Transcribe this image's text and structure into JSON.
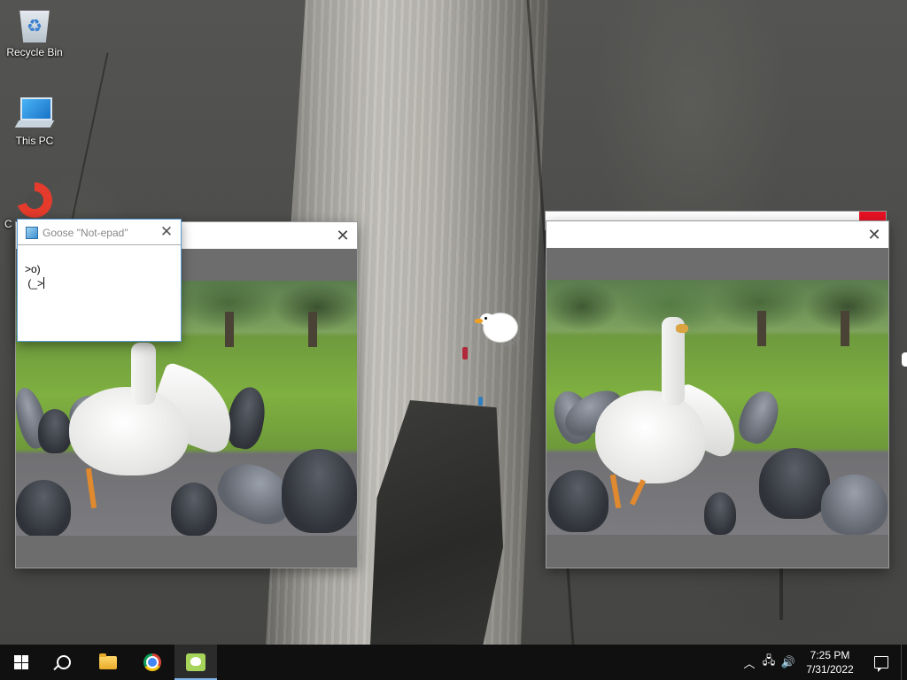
{
  "desktop": {
    "icons": [
      {
        "label": "Recycle Bin",
        "icon": "recycle-bin-icon"
      },
      {
        "label": "This PC",
        "icon": "this-pc-icon"
      },
      {
        "label": "C",
        "icon": "ccleaner-icon"
      }
    ]
  },
  "notepad": {
    "title": "Goose \"Not-epad\"",
    "close_glyph": "✕",
    "content": ">o)\n (_>"
  },
  "video_windows": [
    {
      "close_glyph": "✕"
    },
    {
      "close_glyph": "✕"
    }
  ],
  "taskbar": {
    "time": "7:25 PM",
    "date": "7/31/2022",
    "tray": {
      "chevron": "︿",
      "network": "🖧",
      "volume": "🔊"
    },
    "apps": [
      {
        "name": "start",
        "icon": "windows-logo-icon"
      },
      {
        "name": "search",
        "icon": "search-icon"
      },
      {
        "name": "file-explorer",
        "icon": "folder-icon"
      },
      {
        "name": "chrome",
        "icon": "chrome-icon"
      },
      {
        "name": "desktop-goose",
        "icon": "goose-app-icon",
        "active": true
      }
    ]
  },
  "colors": {
    "taskbar": "#101010",
    "active_underline": "#7fb2e8",
    "close_red": "#e81123",
    "notepad_border": "#5b9bd5"
  }
}
